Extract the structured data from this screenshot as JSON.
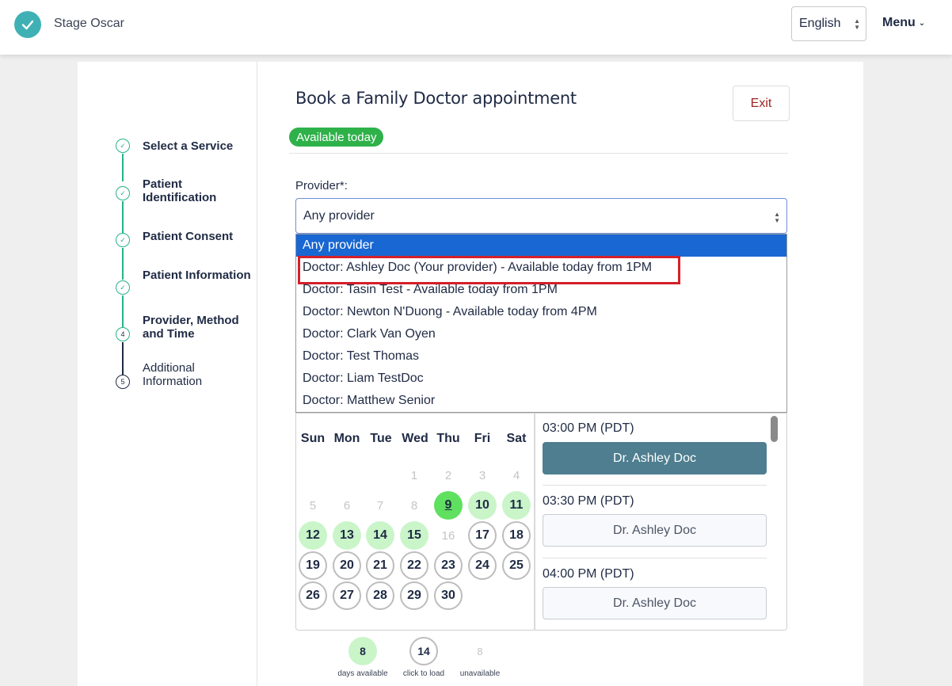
{
  "header": {
    "app_name": "Stage Oscar",
    "language": "English",
    "menu_label": "Menu"
  },
  "steps": [
    {
      "label": "Select a Service",
      "state": "done"
    },
    {
      "label": "Patient Identification",
      "state": "done"
    },
    {
      "label": "Patient Consent",
      "state": "done"
    },
    {
      "label": "Patient Information",
      "state": "done"
    },
    {
      "label": "Provider, Method and Time",
      "state": "current",
      "number": "4"
    },
    {
      "label": "Additional Information",
      "state": "pending",
      "number": "5"
    }
  ],
  "page": {
    "title": "Book a Family Doctor appointment",
    "exit_label": "Exit",
    "badge": "Available today",
    "provider_label": "Provider*:",
    "provider_value": "Any provider"
  },
  "provider_options": [
    "Any provider",
    "Doctor: Ashley Doc (Your provider) - Available today from 1PM",
    "Doctor: Tasin Test - Available today from 1PM",
    "Doctor: Newton N'Duong - Available today from 4PM",
    "Doctor: Clark Van Oyen",
    "Doctor: Test Thomas",
    "Doctor: Liam TestDoc",
    "Doctor: Matthew Senior"
  ],
  "calendar": {
    "weekdays": [
      "Sun",
      "Mon",
      "Tue",
      "Wed",
      "Thu",
      "Fri",
      "Sat"
    ],
    "days": [
      {
        "d": "1",
        "s": "disabled"
      },
      {
        "d": "2",
        "s": "disabled"
      },
      {
        "d": "3",
        "s": "disabled"
      },
      {
        "d": "4",
        "s": "disabled"
      },
      {
        "d": "5",
        "s": "disabled"
      },
      {
        "d": "6",
        "s": "disabled"
      },
      {
        "d": "7",
        "s": "disabled"
      },
      {
        "d": "8",
        "s": "disabled"
      },
      {
        "d": "9",
        "s": "today"
      },
      {
        "d": "10",
        "s": "avail"
      },
      {
        "d": "11",
        "s": "avail"
      },
      {
        "d": "12",
        "s": "avail"
      },
      {
        "d": "13",
        "s": "avail"
      },
      {
        "d": "14",
        "s": "avail"
      },
      {
        "d": "15",
        "s": "avail"
      },
      {
        "d": "16",
        "s": "disabled"
      },
      {
        "d": "17",
        "s": "load"
      },
      {
        "d": "18",
        "s": "load"
      },
      {
        "d": "19",
        "s": "load"
      },
      {
        "d": "20",
        "s": "load"
      },
      {
        "d": "21",
        "s": "load"
      },
      {
        "d": "22",
        "s": "load"
      },
      {
        "d": "23",
        "s": "load"
      },
      {
        "d": "24",
        "s": "load"
      },
      {
        "d": "25",
        "s": "load"
      },
      {
        "d": "26",
        "s": "load"
      },
      {
        "d": "27",
        "s": "load"
      },
      {
        "d": "28",
        "s": "load"
      },
      {
        "d": "29",
        "s": "load"
      },
      {
        "d": "30",
        "s": "load"
      }
    ]
  },
  "slots": [
    {
      "time": "03:00 PM (PDT)",
      "provider": "Dr. Ashley Doc",
      "selected": true
    },
    {
      "time": "03:30 PM (PDT)",
      "provider": "Dr. Ashley Doc",
      "selected": false
    },
    {
      "time": "04:00 PM (PDT)",
      "provider": "Dr. Ashley Doc",
      "selected": false
    }
  ],
  "legend": [
    {
      "value": "8",
      "label": "days available",
      "kind": "avail"
    },
    {
      "value": "14",
      "label": "click to load",
      "kind": "load"
    },
    {
      "value": "8",
      "label": "unavailable",
      "kind": "unav"
    }
  ],
  "colors": {
    "accent": "#3fb1b5",
    "step_done": "#27b38a",
    "badge": "#2fb14a",
    "selected_option": "#1967d2",
    "highlight": "#d4202a",
    "slot_active": "#4e7e8f",
    "day_available": "#c9f5c9",
    "day_today": "#5fe05f"
  }
}
